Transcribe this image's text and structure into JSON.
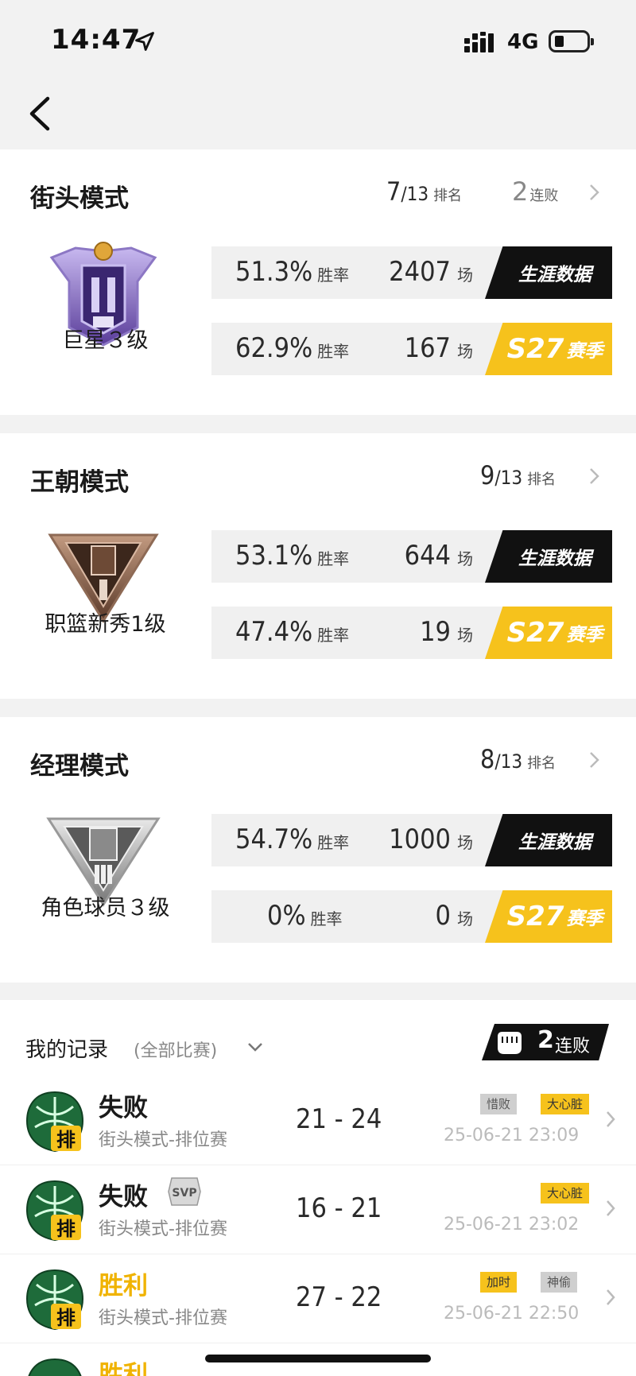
{
  "status_bar": {
    "time": "14:47",
    "network": "4G"
  },
  "modes": [
    {
      "title": "街头模式",
      "rank_num": "7",
      "rank_total": "/13",
      "rank_label": "排名",
      "streak_num": "2",
      "streak_label": "连败",
      "badge_name": "巨星３级",
      "career": {
        "winrate": "51.3%",
        "winrate_label": "胜率",
        "games": "2407",
        "games_label": "场",
        "button": "生涯数据"
      },
      "season": {
        "winrate": "62.9%",
        "winrate_label": "胜率",
        "games": "167",
        "games_label": "场",
        "season_code": "S27",
        "season_label": "赛季"
      }
    },
    {
      "title": "王朝模式",
      "rank_num": "9",
      "rank_total": "/13",
      "rank_label": "排名",
      "badge_name": "职篮新秀1级",
      "career": {
        "winrate": "53.1%",
        "winrate_label": "胜率",
        "games": "644",
        "games_label": "场",
        "button": "生涯数据"
      },
      "season": {
        "winrate": "47.4%",
        "winrate_label": "胜率",
        "games": "19",
        "games_label": "场",
        "season_code": "S27",
        "season_label": "赛季"
      }
    },
    {
      "title": "经理模式",
      "rank_num": "8",
      "rank_total": "/13",
      "rank_label": "排名",
      "badge_name": "角色球员３级",
      "career": {
        "winrate": "54.7%",
        "winrate_label": "胜率",
        "games": "1000",
        "games_label": "场",
        "button": "生涯数据"
      },
      "season": {
        "winrate": "0%",
        "winrate_label": "胜率",
        "games": "0",
        "games_label": "场",
        "season_code": "S27",
        "season_label": "赛季"
      }
    }
  ],
  "records": {
    "title": "我的记录",
    "filter": "(全部比赛)",
    "streak_num": "2",
    "streak_label": "连败",
    "icon_char": "排",
    "svp_label": "SVP",
    "matches": [
      {
        "result": "失败",
        "mode": "街头模式-排位赛",
        "score": "21 - 24",
        "time": "25-06-21 23:09",
        "tags": [
          "惜败",
          "大心脏"
        ]
      },
      {
        "result": "失败",
        "mode": "街头模式-排位赛",
        "score": "16 - 21",
        "time": "25-06-21 23:02",
        "tags": [
          "大心脏"
        ]
      },
      {
        "result": "胜利",
        "mode": "街头模式-排位赛",
        "score": "27 - 22",
        "time": "25-06-21 22:50",
        "tags": [
          "加时",
          "神偷"
        ]
      },
      {
        "result": "胜利"
      }
    ]
  },
  "colors": {
    "accent_yellow": "#f6c21c",
    "career_black": "#111111",
    "win_color": "#f0b300"
  }
}
